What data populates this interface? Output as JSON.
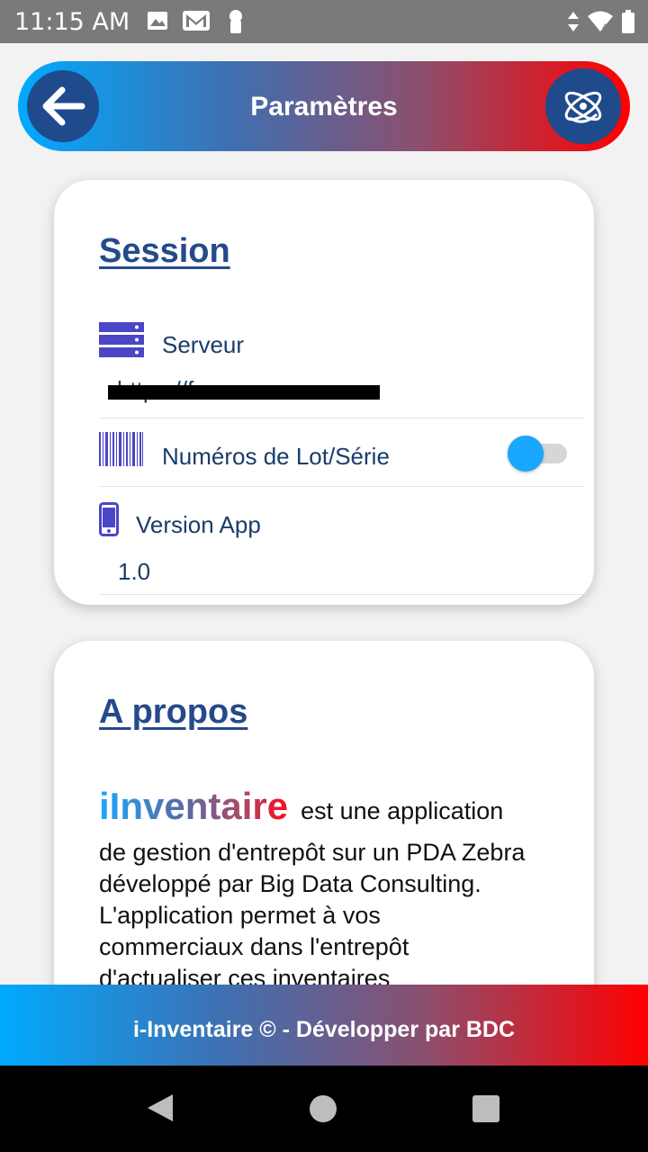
{
  "status_bar": {
    "time": "11:15 AM",
    "icons": [
      "image-icon",
      "gmail-icon",
      "keyhole-icon"
    ],
    "right_icons": [
      "data-arrows-icon",
      "wifi-icon",
      "battery-icon"
    ]
  },
  "header": {
    "title": "Paramètres",
    "back_icon": "arrow-left-icon",
    "logo_icon": "atom-logo-icon"
  },
  "session": {
    "heading": "Session",
    "server_label": "Serveur",
    "server_value": "https://f...",
    "lot_label": "Numéros de Lot/Série",
    "lot_toggle_on": false,
    "version_label": "Version App",
    "version_value": "1.0"
  },
  "about": {
    "heading": "A propos",
    "brand": "iInventaire",
    "first_line_rest": "est une application",
    "text": "de gestion d'entrepôt sur un PDA Zebra développé par Big Data Consulting. L'application permet à vos commerciaux dans l'entrepôt d'actualiser ces inventaires"
  },
  "footer": {
    "text": "i-Inventaire © - Développer par BDC"
  },
  "colors": {
    "accent_blue": "#00aaff",
    "accent_red": "#ff0000",
    "heading_blue": "#244a8a",
    "icon_purple": "#4b46c8"
  }
}
